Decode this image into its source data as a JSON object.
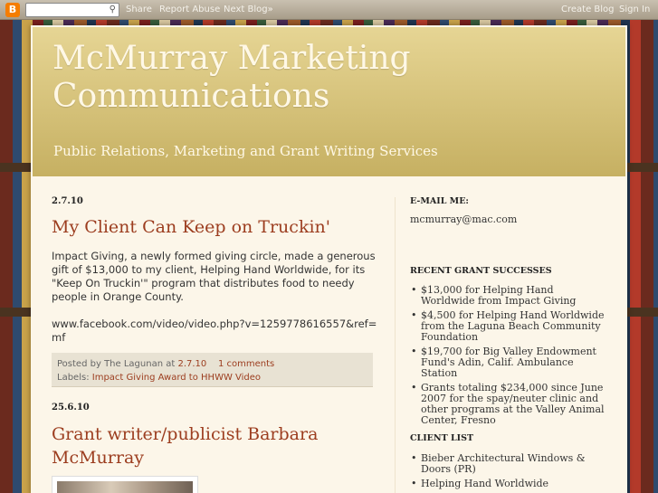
{
  "navbar": {
    "logo_glyph": "B",
    "search_placeholder": "",
    "share": "Share",
    "report_abuse": "Report Abuse",
    "next_blog": "Next Blog»",
    "create_blog": "Create Blog",
    "sign_in": "Sign In"
  },
  "header": {
    "title": "McMurray Marketing Communications",
    "description": "Public Relations, Marketing and Grant Writing Services"
  },
  "posts": [
    {
      "date": "2.7.10",
      "title": "My Client Can Keep on Truckin'",
      "body_p1": "Impact Giving, a newly formed giving circle, made a generous gift of $13,000 to my client, Helping Hand Worldwide, for its \"Keep On Truckin'\" program that distributes food to needy people in Orange County.",
      "body_p2": "www.facebook.com/video/video.php?v=1259778616557&ref=mf",
      "posted_by_prefix": "Posted by",
      "author": "The Lagunan",
      "at": "at",
      "time": "2.7.10",
      "comments": "1 comments",
      "labels_prefix": "Labels:",
      "labels": "Impact Giving Award to HHWW Video"
    },
    {
      "date": "25.6.10",
      "title": "Grant writer/publicist Barbara McMurray"
    }
  ],
  "sidebar": {
    "email_heading": "E-MAIL ME:",
    "email": "mcmurray@mac.com",
    "grants_heading": "RECENT GRANT SUCCESSES",
    "grants": [
      "$13,000 for Helping Hand Worldwide from Impact Giving",
      "$4,500 for Helping Hand Worldwide from the Laguna Beach Community Foundation",
      "$19,700 for Big Valley Endowment Fund's Adin, Calif. Ambulance Station",
      "Grants totaling $234,000 since June 2007 for the spay/neuter clinic and other programs at the Valley Animal Center, Fresno"
    ],
    "clients_heading": "CLIENT LIST",
    "clients": [
      "Bieber Architectural Windows & Doors (PR)",
      "Helping Hand Worldwide"
    ]
  },
  "colors": {
    "link": "#9c3d1f",
    "header_gold": "#c6b062",
    "page_cream": "#fcf6e9"
  }
}
